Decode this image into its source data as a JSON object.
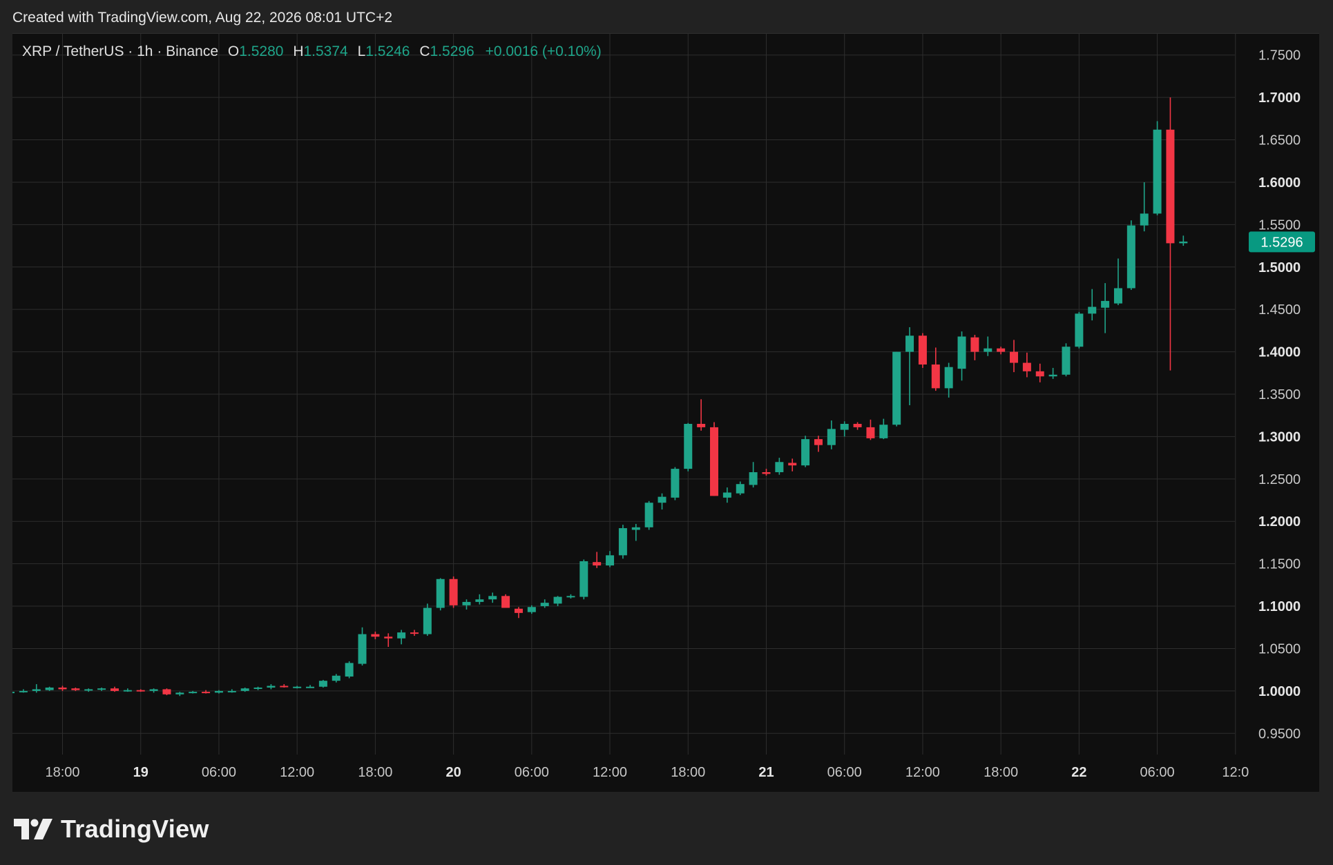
{
  "watermark_top": "Created with TradingView.com, Aug 22, 2026 08:01 UTC+2",
  "legend": {
    "symbol": "XRP / TetherUS · 1h · Binance",
    "open_key": "O",
    "open": "1.5280",
    "high_key": "H",
    "high": "1.5374",
    "low_key": "L",
    "low": "1.5246",
    "close_key": "C",
    "close": "1.5296",
    "change": "+0.0016 (+0.10%)"
  },
  "brand": "TradingView",
  "colors": {
    "up": "#1fa58a",
    "down": "#f23645",
    "grid": "#2e2e2e",
    "background": "#0f0f0f",
    "price_tag": "#089981"
  },
  "chart_data": {
    "type": "candlestick",
    "interval": "1h",
    "y_axis": {
      "ticks": [
        "1.7500",
        "1.7000",
        "1.6500",
        "1.6000",
        "1.5500",
        "1.5000",
        "1.4500",
        "1.4000",
        "1.3500",
        "1.3000",
        "1.2500",
        "1.2000",
        "1.1500",
        "1.1000",
        "1.0500",
        "1.0000",
        "0.9500"
      ],
      "bold_ticks": [
        "1.7000",
        "1.6000",
        "1.5000",
        "1.4000",
        "1.3000",
        "1.2000",
        "1.1000",
        "1.0000"
      ],
      "range": [
        0.925,
        1.775
      ]
    },
    "x_axis": {
      "ticks": [
        {
          "label": "18:00",
          "bold": false
        },
        {
          "label": "19",
          "bold": true
        },
        {
          "label": "06:00",
          "bold": false
        },
        {
          "label": "12:00",
          "bold": false
        },
        {
          "label": "18:00",
          "bold": false
        },
        {
          "label": "20",
          "bold": true
        },
        {
          "label": "06:00",
          "bold": false
        },
        {
          "label": "12:00",
          "bold": false
        },
        {
          "label": "18:00",
          "bold": false
        },
        {
          "label": "21",
          "bold": true
        },
        {
          "label": "06:00",
          "bold": false
        },
        {
          "label": "12:00",
          "bold": false
        },
        {
          "label": "18:00",
          "bold": false
        },
        {
          "label": "22",
          "bold": true
        },
        {
          "label": "06:00",
          "bold": false
        },
        {
          "label": "12:0",
          "bold": false
        }
      ],
      "hours_per_tick": 6,
      "first_tick_candle_index": 4
    },
    "last_price": "1.5296",
    "candles": [
      {
        "o": 0.998,
        "h": 1.001,
        "l": 0.997,
        "c": 0.999
      },
      {
        "o": 0.999,
        "h": 1.002,
        "l": 0.998,
        "c": 1.0
      },
      {
        "o": 1.0,
        "h": 1.008,
        "l": 0.998,
        "c": 1.002
      },
      {
        "o": 1.001,
        "h": 1.005,
        "l": 1.0,
        "c": 1.004
      },
      {
        "o": 1.004,
        "h": 1.006,
        "l": 1.0,
        "c": 1.002
      },
      {
        "o": 1.003,
        "h": 1.004,
        "l": 1.0,
        "c": 1.001
      },
      {
        "o": 1.001,
        "h": 1.003,
        "l": 0.999,
        "c": 1.002
      },
      {
        "o": 1.002,
        "h": 1.004,
        "l": 1.0,
        "c": 1.003
      },
      {
        "o": 1.003,
        "h": 1.005,
        "l": 0.999,
        "c": 1.0
      },
      {
        "o": 1.0,
        "h": 1.003,
        "l": 0.999,
        "c": 1.001
      },
      {
        "o": 1.001,
        "h": 1.002,
        "l": 0.999,
        "c": 1.0
      },
      {
        "o": 1.0,
        "h": 1.003,
        "l": 0.998,
        "c": 1.002
      },
      {
        "o": 1.002,
        "h": 1.003,
        "l": 0.995,
        "c": 0.996
      },
      {
        "o": 0.996,
        "h": 0.999,
        "l": 0.994,
        "c": 0.998
      },
      {
        "o": 0.998,
        "h": 1.0,
        "l": 0.997,
        "c": 0.999
      },
      {
        "o": 0.999,
        "h": 1.001,
        "l": 0.997,
        "c": 0.998
      },
      {
        "o": 0.998,
        "h": 1.001,
        "l": 0.997,
        "c": 1.0
      },
      {
        "o": 1.0,
        "h": 1.002,
        "l": 0.998,
        "c": 1.0
      },
      {
        "o": 1.0,
        "h": 1.004,
        "l": 0.999,
        "c": 1.003
      },
      {
        "o": 1.003,
        "h": 1.005,
        "l": 1.001,
        "c": 1.004
      },
      {
        "o": 1.004,
        "h": 1.008,
        "l": 1.002,
        "c": 1.006
      },
      {
        "o": 1.006,
        "h": 1.008,
        "l": 1.004,
        "c": 1.005
      },
      {
        "o": 1.004,
        "h": 1.006,
        "l": 1.003,
        "c": 1.005
      },
      {
        "o": 1.005,
        "h": 1.007,
        "l": 1.004,
        "c": 1.005
      },
      {
        "o": 1.005,
        "h": 1.013,
        "l": 1.004,
        "c": 1.012
      },
      {
        "o": 1.012,
        "h": 1.02,
        "l": 1.01,
        "c": 1.018
      },
      {
        "o": 1.017,
        "h": 1.035,
        "l": 1.015,
        "c": 1.033
      },
      {
        "o": 1.032,
        "h": 1.075,
        "l": 1.03,
        "c": 1.067
      },
      {
        "o": 1.067,
        "h": 1.07,
        "l": 1.061,
        "c": 1.064
      },
      {
        "o": 1.064,
        "h": 1.068,
        "l": 1.052,
        "c": 1.062
      },
      {
        "o": 1.062,
        "h": 1.072,
        "l": 1.055,
        "c": 1.069
      },
      {
        "o": 1.069,
        "h": 1.072,
        "l": 1.065,
        "c": 1.068
      },
      {
        "o": 1.067,
        "h": 1.103,
        "l": 1.065,
        "c": 1.098
      },
      {
        "o": 1.098,
        "h": 1.133,
        "l": 1.095,
        "c": 1.132
      },
      {
        "o": 1.132,
        "h": 1.135,
        "l": 1.098,
        "c": 1.101
      },
      {
        "o": 1.101,
        "h": 1.108,
        "l": 1.096,
        "c": 1.105
      },
      {
        "o": 1.105,
        "h": 1.114,
        "l": 1.102,
        "c": 1.108
      },
      {
        "o": 1.108,
        "h": 1.116,
        "l": 1.104,
        "c": 1.112
      },
      {
        "o": 1.112,
        "h": 1.114,
        "l": 1.098,
        "c": 1.098
      },
      {
        "o": 1.097,
        "h": 1.099,
        "l": 1.086,
        "c": 1.092
      },
      {
        "o": 1.093,
        "h": 1.101,
        "l": 1.091,
        "c": 1.099
      },
      {
        "o": 1.1,
        "h": 1.108,
        "l": 1.098,
        "c": 1.104
      },
      {
        "o": 1.103,
        "h": 1.112,
        "l": 1.1,
        "c": 1.111
      },
      {
        "o": 1.111,
        "h": 1.114,
        "l": 1.109,
        "c": 1.112
      },
      {
        "o": 1.111,
        "h": 1.155,
        "l": 1.108,
        "c": 1.153
      },
      {
        "o": 1.152,
        "h": 1.164,
        "l": 1.145,
        "c": 1.148
      },
      {
        "o": 1.148,
        "h": 1.165,
        "l": 1.146,
        "c": 1.16
      },
      {
        "o": 1.16,
        "h": 1.196,
        "l": 1.156,
        "c": 1.192
      },
      {
        "o": 1.19,
        "h": 1.197,
        "l": 1.177,
        "c": 1.193
      },
      {
        "o": 1.193,
        "h": 1.224,
        "l": 1.19,
        "c": 1.222
      },
      {
        "o": 1.222,
        "h": 1.233,
        "l": 1.214,
        "c": 1.229
      },
      {
        "o": 1.228,
        "h": 1.264,
        "l": 1.225,
        "c": 1.262
      },
      {
        "o": 1.262,
        "h": 1.316,
        "l": 1.259,
        "c": 1.315
      },
      {
        "o": 1.315,
        "h": 1.344,
        "l": 1.307,
        "c": 1.311
      },
      {
        "o": 1.311,
        "h": 1.317,
        "l": 1.23,
        "c": 1.23
      },
      {
        "o": 1.228,
        "h": 1.24,
        "l": 1.222,
        "c": 1.234
      },
      {
        "o": 1.233,
        "h": 1.247,
        "l": 1.231,
        "c": 1.244
      },
      {
        "o": 1.243,
        "h": 1.27,
        "l": 1.24,
        "c": 1.258
      },
      {
        "o": 1.258,
        "h": 1.262,
        "l": 1.254,
        "c": 1.256
      },
      {
        "o": 1.258,
        "h": 1.275,
        "l": 1.255,
        "c": 1.27
      },
      {
        "o": 1.269,
        "h": 1.274,
        "l": 1.259,
        "c": 1.266
      },
      {
        "o": 1.266,
        "h": 1.301,
        "l": 1.264,
        "c": 1.297
      },
      {
        "o": 1.297,
        "h": 1.301,
        "l": 1.282,
        "c": 1.29
      },
      {
        "o": 1.29,
        "h": 1.319,
        "l": 1.285,
        "c": 1.309
      },
      {
        "o": 1.308,
        "h": 1.318,
        "l": 1.3,
        "c": 1.315
      },
      {
        "o": 1.315,
        "h": 1.317,
        "l": 1.308,
        "c": 1.311
      },
      {
        "o": 1.311,
        "h": 1.32,
        "l": 1.296,
        "c": 1.298
      },
      {
        "o": 1.298,
        "h": 1.321,
        "l": 1.297,
        "c": 1.314
      },
      {
        "o": 1.314,
        "h": 1.4,
        "l": 1.312,
        "c": 1.4
      },
      {
        "o": 1.4,
        "h": 1.429,
        "l": 1.337,
        "c": 1.419
      },
      {
        "o": 1.419,
        "h": 1.422,
        "l": 1.381,
        "c": 1.385
      },
      {
        "o": 1.385,
        "h": 1.405,
        "l": 1.354,
        "c": 1.357
      },
      {
        "o": 1.357,
        "h": 1.387,
        "l": 1.346,
        "c": 1.382
      },
      {
        "o": 1.38,
        "h": 1.424,
        "l": 1.366,
        "c": 1.418
      },
      {
        "o": 1.417,
        "h": 1.42,
        "l": 1.39,
        "c": 1.4
      },
      {
        "o": 1.4,
        "h": 1.418,
        "l": 1.395,
        "c": 1.404
      },
      {
        "o": 1.404,
        "h": 1.406,
        "l": 1.397,
        "c": 1.4
      },
      {
        "o": 1.4,
        "h": 1.414,
        "l": 1.376,
        "c": 1.387
      },
      {
        "o": 1.387,
        "h": 1.399,
        "l": 1.37,
        "c": 1.377
      },
      {
        "o": 1.377,
        "h": 1.386,
        "l": 1.364,
        "c": 1.371
      },
      {
        "o": 1.371,
        "h": 1.381,
        "l": 1.368,
        "c": 1.373
      },
      {
        "o": 1.373,
        "h": 1.41,
        "l": 1.371,
        "c": 1.406
      },
      {
        "o": 1.406,
        "h": 1.447,
        "l": 1.404,
        "c": 1.445
      },
      {
        "o": 1.445,
        "h": 1.474,
        "l": 1.437,
        "c": 1.453
      },
      {
        "o": 1.452,
        "h": 1.481,
        "l": 1.422,
        "c": 1.46
      },
      {
        "o": 1.457,
        "h": 1.51,
        "l": 1.455,
        "c": 1.475
      },
      {
        "o": 1.475,
        "h": 1.555,
        "l": 1.473,
        "c": 1.549
      },
      {
        "o": 1.549,
        "h": 1.6,
        "l": 1.542,
        "c": 1.563
      },
      {
        "o": 1.563,
        "h": 1.672,
        "l": 1.561,
        "c": 1.662
      },
      {
        "o": 1.662,
        "h": 1.7,
        "l": 1.378,
        "c": 1.528
      },
      {
        "o": 1.528,
        "h": 1.537,
        "l": 1.525,
        "c": 1.53
      }
    ]
  }
}
